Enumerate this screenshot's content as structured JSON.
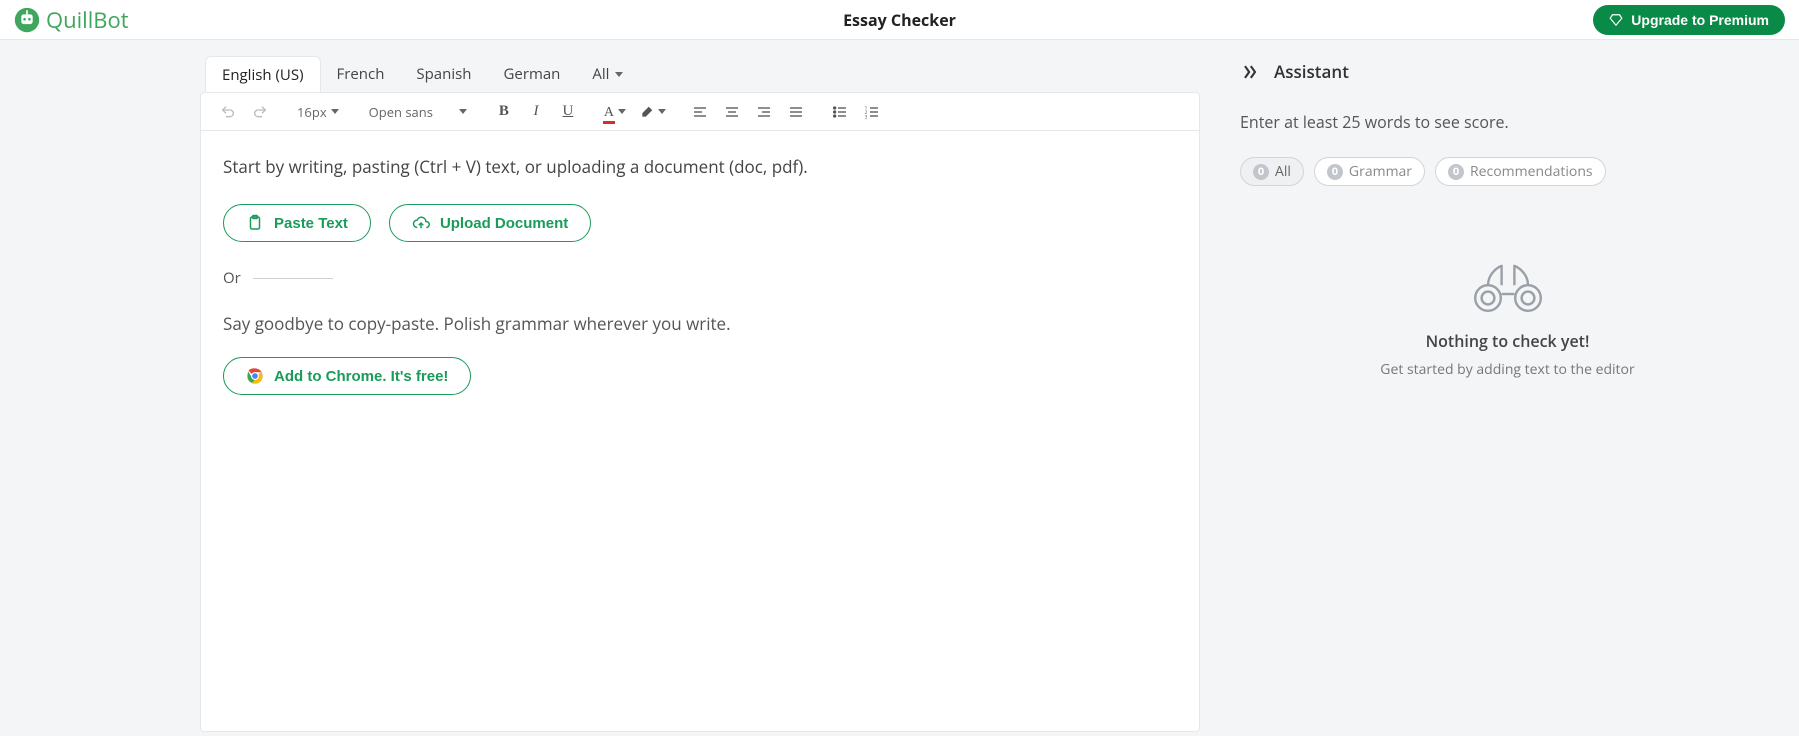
{
  "header": {
    "brand": "QuillBot",
    "title": "Essay Checker",
    "upgrade": "Upgrade to Premium"
  },
  "tabs": {
    "lang0": "English (US)",
    "lang1": "French",
    "lang2": "Spanish",
    "lang3": "German",
    "lang4": "All"
  },
  "toolbar": {
    "fontSize": "16px",
    "fontFamily": "Open sans"
  },
  "editor": {
    "placeholder": "Start by writing, pasting (Ctrl + V) text, or uploading a document (doc, pdf).",
    "paste": "Paste Text",
    "upload": "Upload Document",
    "or": "Or",
    "tagline": "Say goodbye to copy-paste. Polish grammar wherever you write.",
    "chrome": "Add to Chrome. It's free!"
  },
  "assistant": {
    "title": "Assistant",
    "hint": "Enter at least 25 words to see score.",
    "chips": {
      "all": "All",
      "allCount": "0",
      "grammar": "Grammar",
      "grammarCount": "0",
      "recs": "Recommendations",
      "recsCount": "0"
    },
    "emptyTitle": "Nothing to check yet!",
    "emptySub": "Get started by adding text to the editor"
  }
}
